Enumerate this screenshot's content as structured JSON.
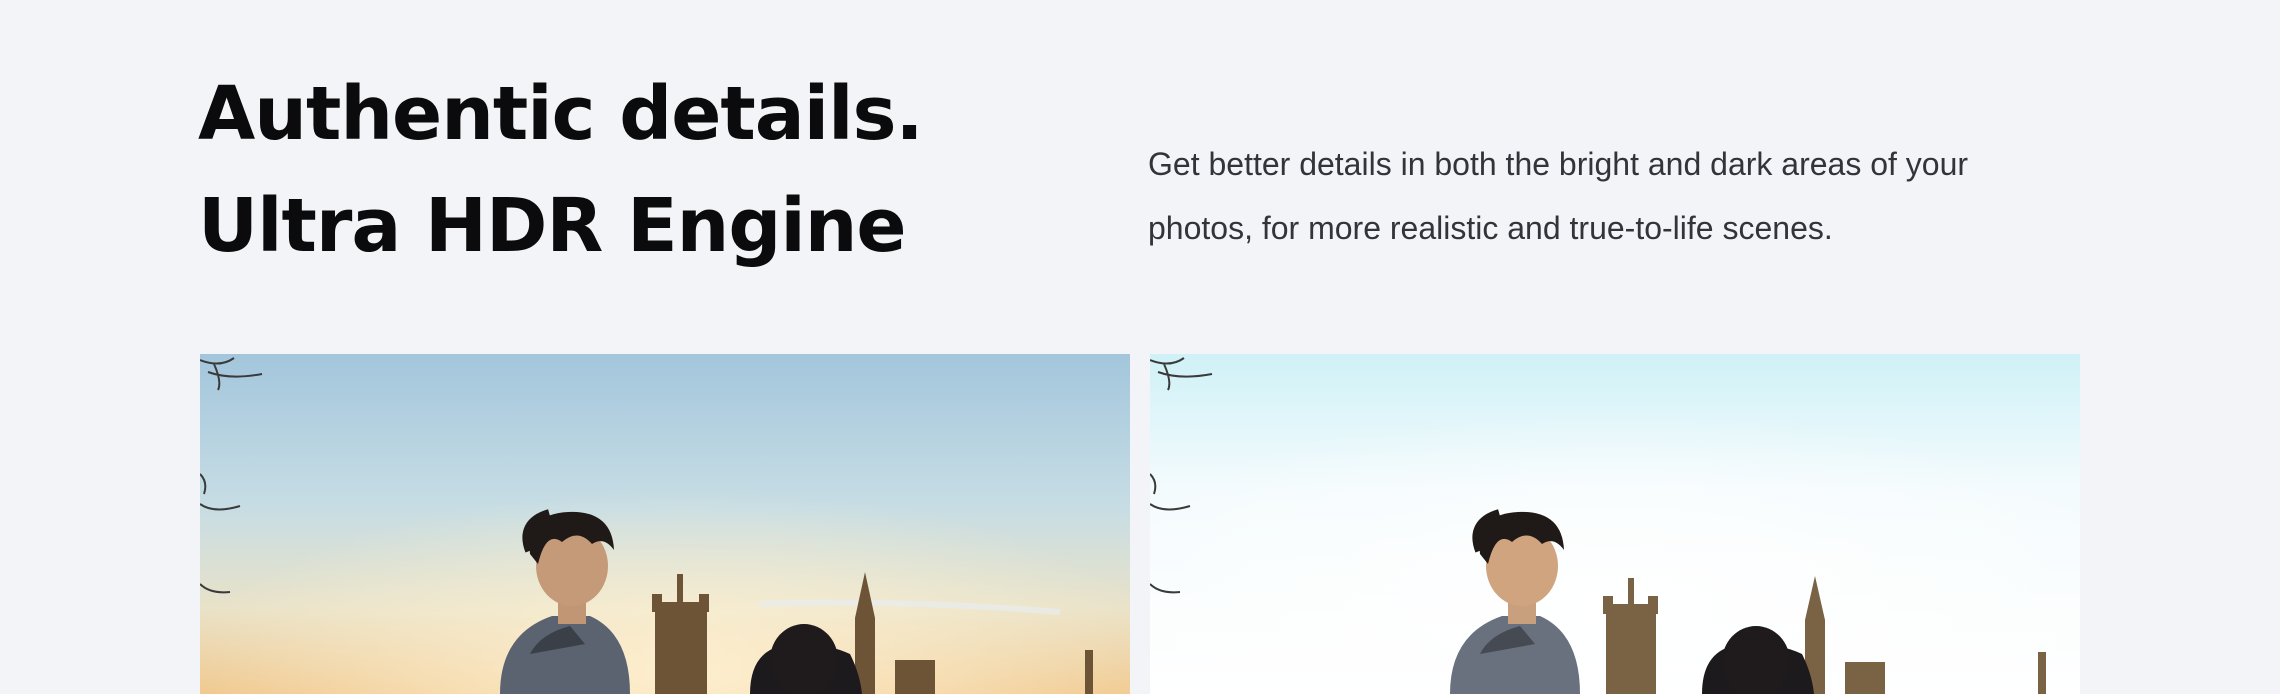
{
  "section": {
    "title_line1": "Authentic details.",
    "title_line2": "Ultra HDR Engine",
    "description": "Get better details in both the bright and dark areas of your photos, for more realistic and true-to-life scenes."
  },
  "comparison": {
    "left_photo": "standard-photo",
    "right_photo": "ultra-hdr-photo"
  },
  "colors": {
    "background": "#f3f4f7",
    "heading": "#0b0b0d",
    "body_text": "#33343a",
    "left_sky_top": "#a3c6dc",
    "right_sky_top": "#cff1f7"
  }
}
